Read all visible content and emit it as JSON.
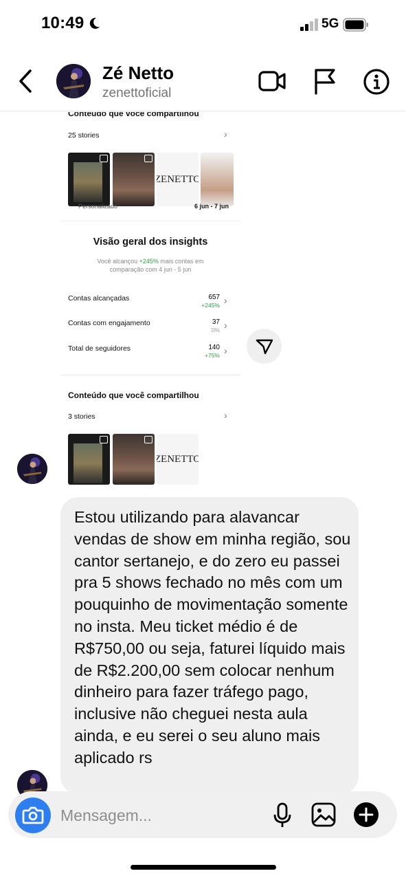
{
  "status_bar": {
    "time": "10:49",
    "network": "5G"
  },
  "header": {
    "name": "Zé Netto",
    "username": "zenettoficial"
  },
  "shared_card": {
    "top_cut_title": "Conteudo que voce compartilhou",
    "stories_count_top": "25 stories",
    "thumb_logo_text": "ZENETTO",
    "filter_left": "Personalizado",
    "filter_right": "6 jun - 7 jun",
    "insights_title": "Visão geral dos insights",
    "reach_prefix": "Você alcançou",
    "reach_pct": "+245%",
    "reach_suffix": "mais contas em",
    "reach_line2": "comparação com 4 jun - 5 jun",
    "stats": [
      {
        "label": "Contas alcançadas",
        "value": "657",
        "change": "+245%"
      },
      {
        "label": "Contas com engajamento",
        "value": "37",
        "change": "0%"
      },
      {
        "label": "Total de seguidores",
        "value": "140",
        "change": "+75%"
      }
    ],
    "shared_title": "Conteúdo que você compartilhou",
    "stories_count": "3 stories"
  },
  "message": {
    "text": "Estou utilizando para alavancar vendas de show em minha região, sou cantor sertanejo, e do zero eu passei pra 5 shows fechado no mês com um pouquinho de movimentação somente no insta. Meu ticket médio é de R$750,00 ou seja, faturei líquido mais de R$2.200,00 sem colocar nenhum dinheiro para fazer tráfego pago, inclusive não cheguei nesta aula ainda, e eu serei o seu aluno mais aplicado rs"
  },
  "composer": {
    "placeholder": "Mensagem..."
  },
  "colors": {
    "accent": "#2f7ef0",
    "bubble": "#efefef",
    "positive": "#2e9e4a"
  }
}
